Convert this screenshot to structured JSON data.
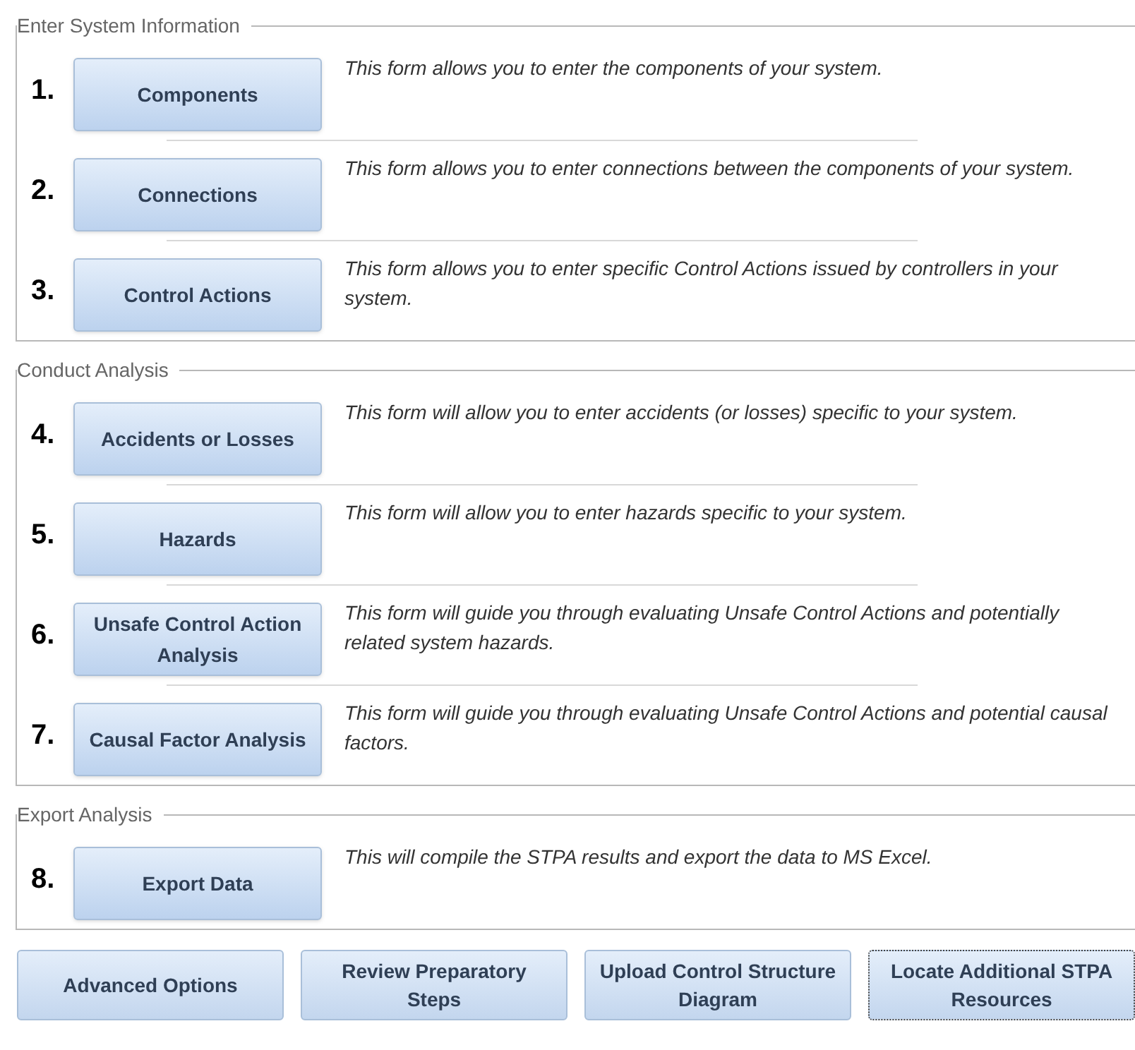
{
  "sections": [
    {
      "title": "Enter System Information",
      "rows": [
        {
          "number": "1.",
          "button": "Components",
          "description": "This form allows you to enter the components of your system."
        },
        {
          "number": "2.",
          "button": "Connections",
          "description": "This form allows you to enter connections between the components of your system."
        },
        {
          "number": "3.",
          "button": "Control Actions",
          "description": "This form allows you to enter specific Control Actions issued by controllers in your system."
        }
      ]
    },
    {
      "title": "Conduct Analysis",
      "rows": [
        {
          "number": "4.",
          "button": "Accidents or Losses",
          "description": "This form will allow you to enter accidents (or losses) specific to your system."
        },
        {
          "number": "5.",
          "button": "Hazards",
          "description": "This form will allow you to enter hazards specific to your system."
        },
        {
          "number": "6.",
          "button": "Unsafe Control Action Analysis",
          "description": "This form will guide you through evaluating Unsafe Control Actions and potentially related system hazards."
        },
        {
          "number": "7.",
          "button": "Causal Factor Analysis",
          "description": "This form will guide you through evaluating Unsafe Control Actions and potential causal factors."
        }
      ]
    },
    {
      "title": "Export Analysis",
      "rows": [
        {
          "number": "8.",
          "button": "Export Data",
          "description": "This will compile the STPA results and export the data to MS Excel."
        }
      ]
    }
  ],
  "footer_buttons": [
    {
      "label": "Advanced Options",
      "focused": false
    },
    {
      "label": "Review Preparatory Steps",
      "focused": false
    },
    {
      "label": "Upload Control Structure Diagram",
      "focused": false
    },
    {
      "label": "Locate Additional STPA Resources",
      "focused": true
    }
  ]
}
